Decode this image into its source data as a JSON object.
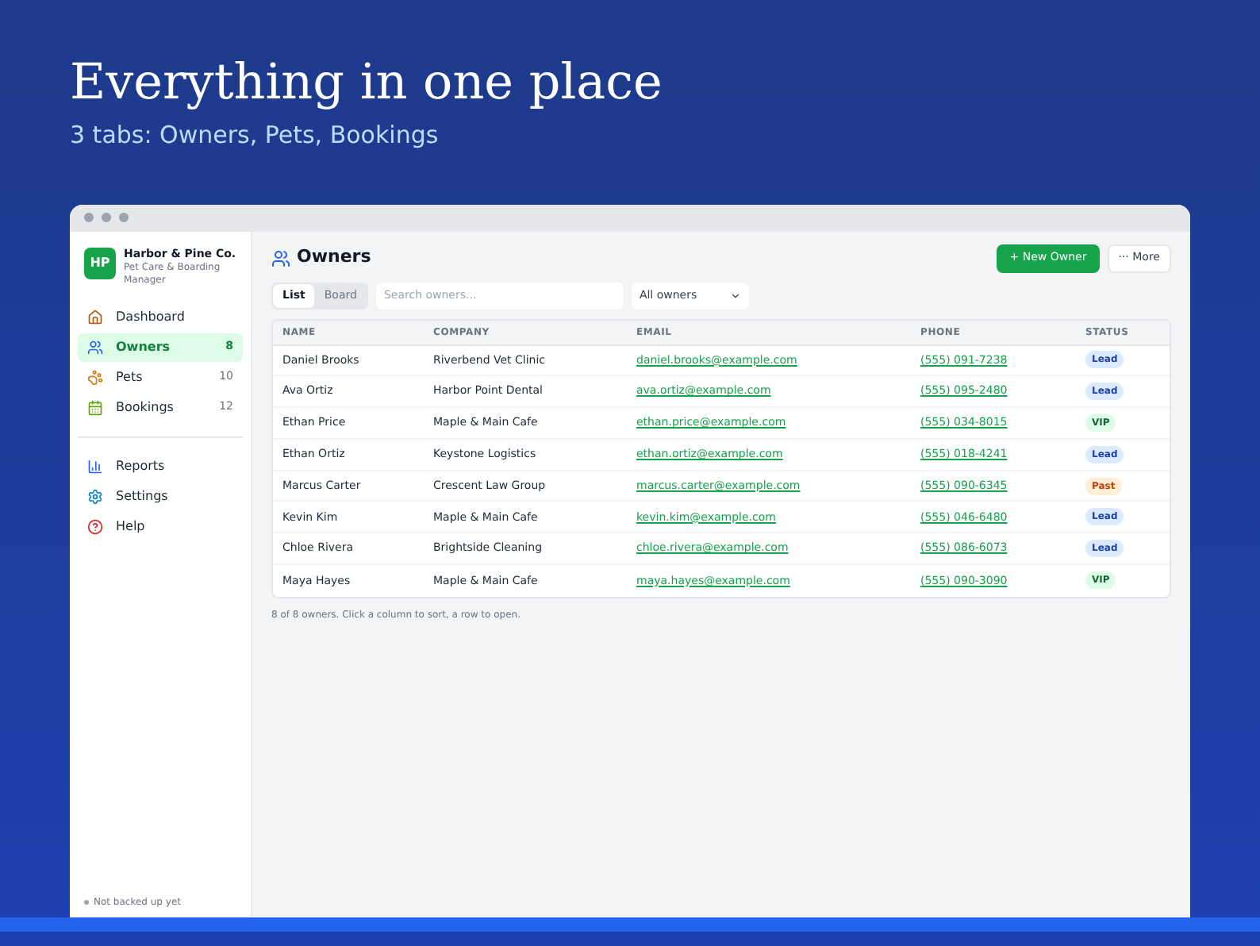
{
  "hero": {
    "title": "Everything in one place",
    "subtitle": "3 tabs: Owners, Pets, Bookings"
  },
  "brand": {
    "initials": "HP",
    "name": "Harbor & Pine Co.",
    "tagline": "Pet Care & Boarding Manager"
  },
  "nav": [
    {
      "label": "Dashboard",
      "kind": "house",
      "selected": false
    },
    {
      "label": "Owners",
      "kind": "people",
      "count": "8",
      "selected": true
    },
    {
      "label": "Pets",
      "kind": "paw",
      "count": "10",
      "selected": false
    },
    {
      "label": "Bookings",
      "kind": "calendar",
      "count": "12",
      "selected": false
    }
  ],
  "nav_secondary": [
    {
      "label": "Reports",
      "kind": "chart",
      "selected": false
    },
    {
      "label": "Settings",
      "kind": "gear",
      "selected": false
    },
    {
      "label": "Help",
      "kind": "help",
      "selected": false
    }
  ],
  "backup_status": "Not backed up yet",
  "page_title": "Owners",
  "actions": {
    "primary": "+ New Owner",
    "secondary": "··· More"
  },
  "view_tabs": [
    {
      "label": "List",
      "selected": true
    },
    {
      "label": "Board",
      "selected": false
    }
  ],
  "search": {
    "placeholder": "Search owners..."
  },
  "filter": {
    "value": "All owners"
  },
  "table": {
    "columns": [
      "NAME",
      "COMPANY",
      "EMAIL",
      "PHONE",
      "STATUS"
    ],
    "rows": [
      {
        "name": "Daniel Brooks",
        "company": "Riverbend Vet Clinic",
        "email": "daniel.brooks@example.com",
        "phone": "(555) 091-7238",
        "status": "Lead",
        "color": "#1e40af"
      },
      {
        "name": "Ava Ortiz",
        "company": "Harbor Point Dental",
        "email": "ava.ortiz@example.com",
        "phone": "(555) 095-2480",
        "status": "Lead",
        "color": "#1e40af"
      },
      {
        "name": "Ethan Price",
        "company": "Maple & Main Cafe",
        "email": "ethan.price@example.com",
        "phone": "(555) 034-8015",
        "status": "VIP",
        "color": "#166534"
      },
      {
        "name": "Ethan Ortiz",
        "company": "Keystone Logistics",
        "email": "ethan.ortiz@example.com",
        "phone": "(555) 018-4241",
        "status": "Lead",
        "color": "#1e40af"
      },
      {
        "name": "Marcus Carter",
        "company": "Crescent Law Group",
        "email": "marcus.carter@example.com",
        "phone": "(555) 090-6345",
        "status": "Past",
        "color": "#c2410c"
      },
      {
        "name": "Kevin Kim",
        "company": "Maple & Main Cafe",
        "email": "kevin.kim@example.com",
        "phone": "(555) 046-6480",
        "status": "Lead",
        "color": "#1e40af"
      },
      {
        "name": "Chloe Rivera",
        "company": "Brightside Cleaning",
        "email": "chloe.rivera@example.com",
        "phone": "(555) 086-6073",
        "status": "Lead",
        "color": "#1e40af"
      },
      {
        "name": "Maya Hayes",
        "company": "Maple & Main Cafe",
        "email": "maya.hayes@example.com",
        "phone": "(555) 090-3090",
        "status": "VIP",
        "color": "#166534"
      }
    ]
  },
  "footnote": "8 of 8 owners. Click a column to sort, a row to open."
}
